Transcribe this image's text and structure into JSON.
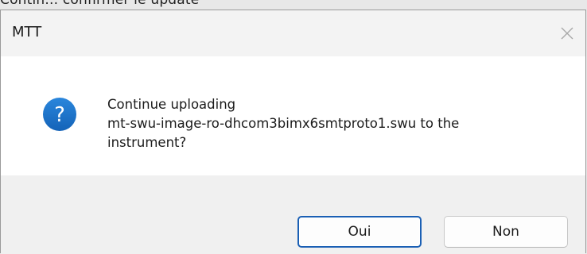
{
  "background": {
    "partial_text": "Contin... confirmer le update"
  },
  "dialog": {
    "title": "MTT",
    "close_icon": "close-icon",
    "message_lines": [
      "Continue uploading",
      "mt-swu-image-ro-dhcom3bimx6smtproto1.swu to the",
      "instrument?"
    ],
    "icon": "question-icon",
    "icon_color": "#1f6fc5",
    "buttons": {
      "yes": "Oui",
      "no": "Non"
    }
  }
}
